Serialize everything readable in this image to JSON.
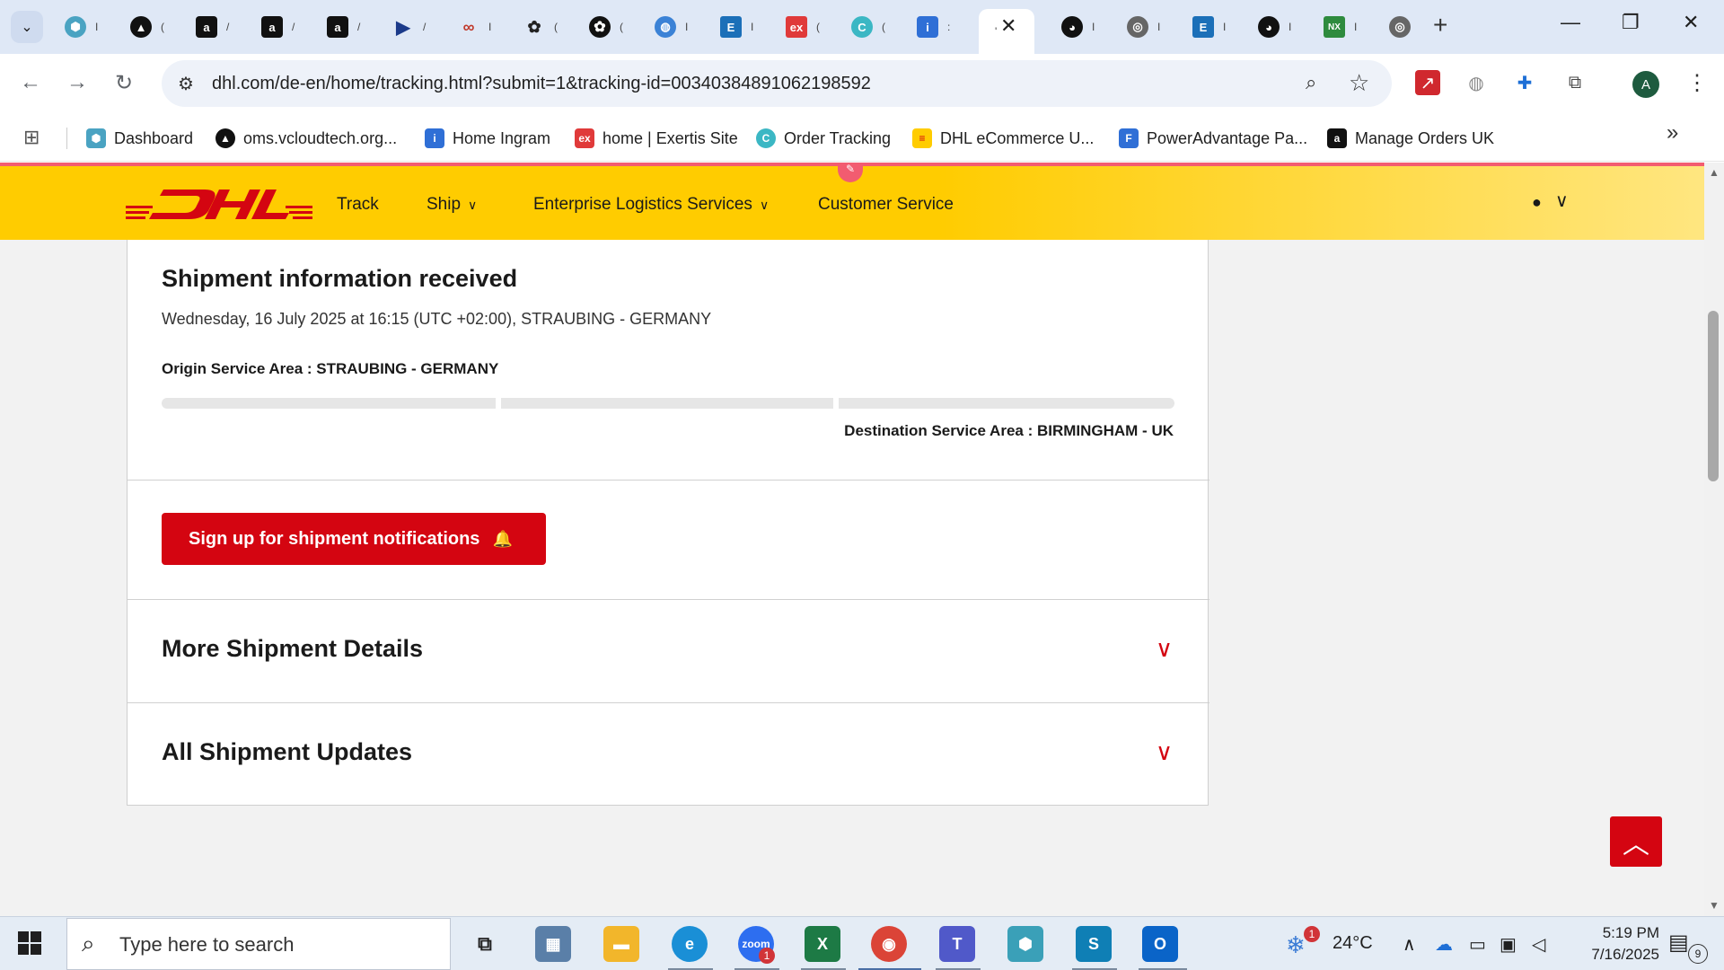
{
  "browser": {
    "tab_tails": [
      "I",
      "(",
      "/",
      "/",
      "/",
      "/",
      "I",
      "(",
      "(",
      "I",
      "I",
      "(",
      "(",
      ":",
      "I",
      "I",
      "I",
      "I",
      "I"
    ],
    "active_tab_label": "'",
    "url": "dhl.com/de-en/home/tracking.html?submit=1&tracking-id=00340384891062198592",
    "profile_initial": "A"
  },
  "bookmarks": [
    {
      "label": "Dashboard",
      "icon": "hexagon-icon",
      "color": "#4aa3c2"
    },
    {
      "label": "oms.vcloudtech.org...",
      "icon": "triangle-icon",
      "color": "#111111"
    },
    {
      "label": "Home Ingram",
      "icon": "ingram-icon",
      "color": "#2f6fd6"
    },
    {
      "label": "home | Exertis Site",
      "icon": "exertis-icon",
      "color": "#e03a3a"
    },
    {
      "label": "Order Tracking",
      "icon": "tracking-icon",
      "color": "#3bb7c4"
    },
    {
      "label": "DHL eCommerce U...",
      "icon": "dhl-icon",
      "color": "#ffcc00"
    },
    {
      "label": "PowerAdvantage Pa...",
      "icon": "poweradvantage-icon",
      "color": "#2f6fd6"
    },
    {
      "label": "Manage Orders UK",
      "icon": "amazon-icon",
      "color": "#111111"
    }
  ],
  "dhl": {
    "nav": {
      "track": "Track",
      "ship": "Ship",
      "enterprise": "Enterprise Logistics Services",
      "customer_service": "Customer Service"
    },
    "shipment": {
      "status_title": "Shipment information received",
      "status_date": "Wednesday, 16 July 2025 at 16:15 (UTC +02:00), STRAUBING - GERMANY",
      "origin": "Origin Service Area : STRAUBING - GERMANY",
      "destination": "Destination Service Area : BIRMINGHAM - UK",
      "notify_button": "Sign up for shipment notifications",
      "more_details": "More Shipment Details",
      "all_updates": "All Shipment Updates"
    },
    "colors": {
      "yellow": "#ffcc00",
      "red": "#d40511"
    }
  },
  "taskbar": {
    "search_placeholder": "Type here to search",
    "weather_temp": "24°C",
    "weather_badge": "1",
    "zoom_badge": "1",
    "time": "5:19 PM",
    "date": "7/16/2025",
    "notification_count": "9"
  }
}
